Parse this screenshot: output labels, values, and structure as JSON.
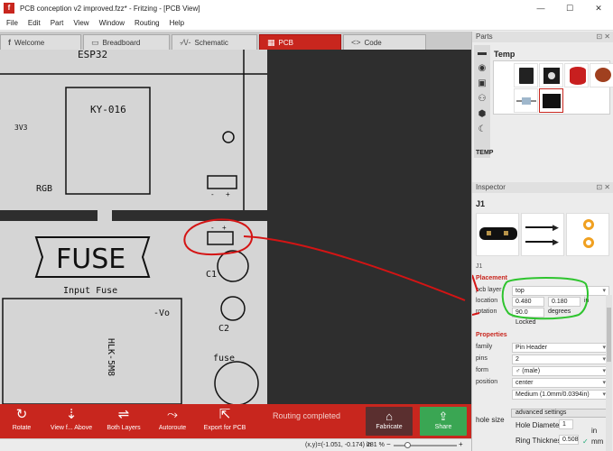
{
  "window": {
    "title": "PCB conception v2 improved.fzz* - Fritzing - [PCB View]",
    "app_icon": "f",
    "buttons": [
      "—",
      "☐",
      "✕"
    ]
  },
  "menu": [
    "File",
    "Edit",
    "Part",
    "View",
    "Window",
    "Routing",
    "Help"
  ],
  "tabs": [
    {
      "label": "Welcome",
      "icon": "f"
    },
    {
      "label": "Breadboard",
      "icon": "▭"
    },
    {
      "label": "Schematic",
      "icon": "-⁄\\/-"
    },
    {
      "label": "PCB",
      "icon": "▦"
    },
    {
      "label": "Code",
      "icon": "<>"
    }
  ],
  "board": {
    "labels": {
      "esp32": "ESP32",
      "ky016": "KY-016",
      "v33": "3V3",
      "rgb": "RGB",
      "fuse": "FUSE",
      "input_fuse": "Input Fuse",
      "c1": "C1",
      "c2": "C2",
      "fuse_small": "fuse",
      "vo": "-Vo",
      "hlk": "HLK-5M8",
      "minus": "-",
      "plus": "+"
    }
  },
  "toolbar": {
    "rotate": "Rotate",
    "view_from": "View f... Above",
    "both_layers": "Both Layers",
    "autoroute": "Autoroute",
    "export": "Export for PCB",
    "status": "Routing completed",
    "fabricate": "Fabricate",
    "share": "Share"
  },
  "statusbar": {
    "coords": "(x,y)=(-1.051, -0.174) in",
    "zoom": "281 %",
    "minus": "−",
    "plus": "+"
  },
  "parts": {
    "header": "Parts",
    "bin_title": "Temp",
    "bin_label": "TEMP",
    "header_buttons": "⊡ ✕"
  },
  "inspector": {
    "header": "Inspector",
    "header_buttons": "⊡ ✕",
    "title": "J1",
    "subtitle": "J1",
    "placement_heading": "Placement",
    "pcb_layer_label": "pcb layer",
    "pcb_layer_value": "top",
    "location_label": "location",
    "location_x": "0.480",
    "location_y": "0.180",
    "location_unit": "in",
    "rotation_label": "rotation",
    "rotation_value": "90.0",
    "rotation_unit": "degrees",
    "locked_label": "Locked",
    "properties_heading": "Properties",
    "family_label": "family",
    "family_value": "Pin Header",
    "pins_label": "pins",
    "pins_value": "2",
    "form_label": "form",
    "form_value": "♂ (male)",
    "position_label": "position",
    "position_value": "center",
    "size_value": "Medium (1.0mm/0.0394in)",
    "hole_size_label": "hole size",
    "advanced_settings": "advanced settings",
    "hole_diameter_label": "Hole Diameter",
    "hole_diameter_value": "1",
    "ring_thickness_label": "Ring Thickness",
    "ring_thickness_value": "0.508",
    "unit_in": "in",
    "unit_mm": "mm",
    "check": "✓"
  },
  "colors": {
    "accent": "#c8261e",
    "board": "#d5d5d5",
    "canvas": "#2e2e2e",
    "share": "#3aa653",
    "annotation_red": "#d41414",
    "annotation_green": "#2ec42e"
  }
}
